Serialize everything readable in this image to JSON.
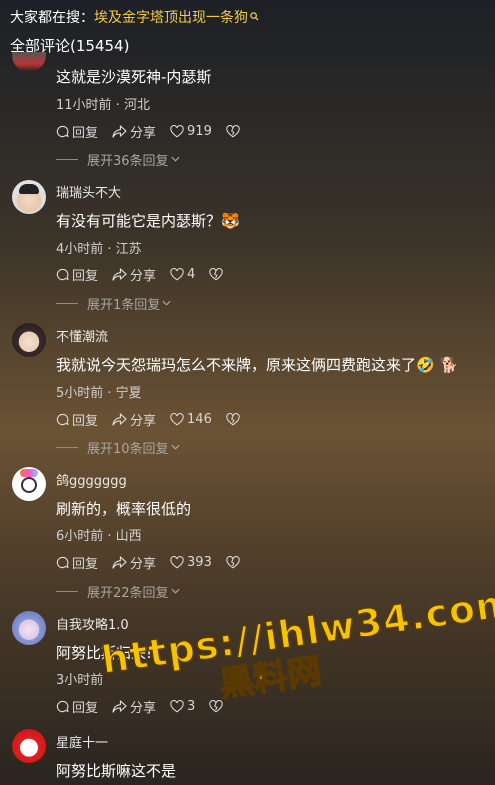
{
  "search": {
    "prefix": "大家都在搜：",
    "term": "埃及金字塔顶出现一条狗",
    "icon": "search-icon"
  },
  "comments_title": "全部评论(15454)",
  "comments": [
    {
      "name": "",
      "text": "这就是沙漠死神-内瑟斯",
      "meta": "11小时前 · 河北",
      "reply": "回复",
      "share": "分享",
      "likes": "919",
      "expand": "展开36条回复"
    },
    {
      "name": "瑞瑞头不大",
      "text": "有没有可能它是内瑟斯？🐯",
      "meta": "4小时前 · 江苏",
      "reply": "回复",
      "share": "分享",
      "likes": "4",
      "expand": "展开1条回复"
    },
    {
      "name": "不懂潮流",
      "text": "我就说今天怨瑞玛怎么不来牌，原来这俩四费跑这来了🤣 🐕",
      "meta": "5小时前 · 宁夏",
      "reply": "回复",
      "share": "分享",
      "likes": "146",
      "expand": "展开10条回复"
    },
    {
      "name": "鸽ggggggg",
      "text": "刷新的，概率很低的",
      "meta": "6小时前 · 山西",
      "reply": "回复",
      "share": "分享",
      "likes": "393",
      "expand": "展开22条回复"
    },
    {
      "name": "自我攻略1.0",
      "text": "阿努比斯归来!",
      "meta": "3小时前",
      "reply": "回复",
      "share": "分享",
      "likes": "3",
      "expand": ""
    },
    {
      "name": "星庭十一",
      "text": "阿努比斯嘛这不是",
      "meta": "",
      "reply": "",
      "share": "",
      "likes": "",
      "expand": ""
    }
  ],
  "watermark": {
    "url": "https://ihlw34.com",
    "text": "黑料网"
  },
  "colors": {
    "accent": "#f2c94c",
    "watermark": "#f5c400"
  }
}
